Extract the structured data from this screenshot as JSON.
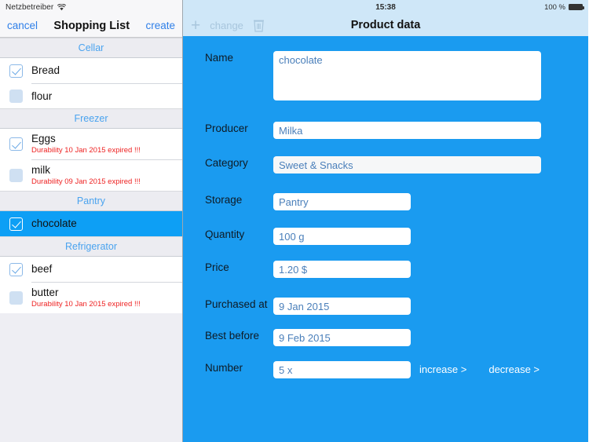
{
  "status_bar": {
    "carrier": "Netzbetreiber",
    "wifi_icon": "wifi-icon",
    "time": "15:38",
    "battery_percent": "100 %",
    "battery_icon": "battery-full-icon"
  },
  "sidebar": {
    "cancel_label": "cancel",
    "title": "Shopping List",
    "create_label": "create",
    "sections": [
      {
        "header": "Cellar",
        "items": [
          {
            "label": "Bread",
            "checked": true,
            "note": ""
          },
          {
            "label": "flour",
            "checked": false,
            "note": ""
          }
        ]
      },
      {
        "header": "Freezer",
        "items": [
          {
            "label": "Eggs",
            "checked": true,
            "note": "Durability 10 Jan 2015 expired !!!"
          },
          {
            "label": "milk",
            "checked": false,
            "note": "Durability 09 Jan 2015 expired !!!"
          }
        ]
      },
      {
        "header": "Pantry",
        "items": [
          {
            "label": "chocolate",
            "checked": true,
            "note": "",
            "selected": true
          }
        ]
      },
      {
        "header": "Refrigerator",
        "items": [
          {
            "label": "beef",
            "checked": true,
            "note": ""
          },
          {
            "label": "butter",
            "checked": false,
            "note": "Durability 10 Jan 2015 expired !!!"
          }
        ]
      }
    ]
  },
  "detail": {
    "toolbar": {
      "add_icon": "plus-icon",
      "change_label": "change",
      "delete_icon": "trash-icon"
    },
    "title": "Product data",
    "fields": [
      {
        "label": "Name",
        "value": "chocolate"
      },
      {
        "label": "Producer",
        "value": "Milka"
      },
      {
        "label": "Category",
        "value": "Sweet & Snacks"
      },
      {
        "label": "Storage",
        "value": "Pantry"
      },
      {
        "label": "Quantity",
        "value": "100 g"
      },
      {
        "label": "Price",
        "value": "1.20 $"
      },
      {
        "label": "Purchased at",
        "value": "9 Jan 2015"
      },
      {
        "label": "Best before",
        "value": "9 Feb 2015"
      },
      {
        "label": "Number",
        "value": "5 x"
      }
    ],
    "increase_label": "increase >",
    "decrease_label": "decrease >"
  },
  "colors": {
    "accent_blue": "#1a9bf0",
    "selected_row": "#0d9ff5",
    "link_blue": "#2f7fe8",
    "section_header_text": "#4aa3ef",
    "expired_red": "#ee2222",
    "field_text": "#4a7fba"
  }
}
